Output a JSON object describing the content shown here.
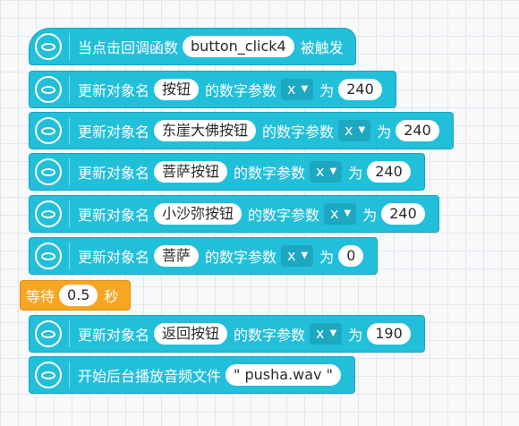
{
  "blocks": [
    {
      "kind": "hat",
      "parts": [
        {
          "t": "text",
          "v": "当点击回调函数"
        },
        {
          "t": "pill",
          "v": "button_click4"
        },
        {
          "t": "text",
          "v": "被触发"
        }
      ]
    },
    {
      "kind": "cmd",
      "parts": [
        {
          "t": "text",
          "v": "更新对象名"
        },
        {
          "t": "pill",
          "v": "按钮"
        },
        {
          "t": "text",
          "v": "的数字参数"
        },
        {
          "t": "drop",
          "v": "x"
        },
        {
          "t": "text",
          "v": "为"
        },
        {
          "t": "pill",
          "v": "240"
        }
      ]
    },
    {
      "kind": "cmd",
      "parts": [
        {
          "t": "text",
          "v": "更新对象名"
        },
        {
          "t": "pill",
          "v": "东崖大佛按钮"
        },
        {
          "t": "text",
          "v": "的数字参数"
        },
        {
          "t": "drop",
          "v": "x"
        },
        {
          "t": "text",
          "v": "为"
        },
        {
          "t": "pill",
          "v": "240"
        }
      ]
    },
    {
      "kind": "cmd",
      "parts": [
        {
          "t": "text",
          "v": "更新对象名"
        },
        {
          "t": "pill",
          "v": "菩萨按钮"
        },
        {
          "t": "text",
          "v": "的数字参数"
        },
        {
          "t": "drop",
          "v": "x"
        },
        {
          "t": "text",
          "v": "为"
        },
        {
          "t": "pill",
          "v": "240"
        }
      ]
    },
    {
      "kind": "cmd",
      "parts": [
        {
          "t": "text",
          "v": "更新对象名"
        },
        {
          "t": "pill",
          "v": "小沙弥按钮"
        },
        {
          "t": "text",
          "v": "的数字参数"
        },
        {
          "t": "drop",
          "v": "x"
        },
        {
          "t": "text",
          "v": "为"
        },
        {
          "t": "pill",
          "v": "240"
        }
      ]
    },
    {
      "kind": "cmd",
      "parts": [
        {
          "t": "text",
          "v": "更新对象名"
        },
        {
          "t": "pill",
          "v": "菩萨"
        },
        {
          "t": "text",
          "v": "的数字参数"
        },
        {
          "t": "drop",
          "v": "x"
        },
        {
          "t": "text",
          "v": "为"
        },
        {
          "t": "pill",
          "v": "0"
        }
      ]
    },
    {
      "kind": "wait",
      "parts": [
        {
          "t": "text",
          "v": "等待"
        },
        {
          "t": "pill",
          "v": "0.5"
        },
        {
          "t": "text",
          "v": "秒"
        }
      ]
    },
    {
      "kind": "cmd",
      "parts": [
        {
          "t": "text",
          "v": "更新对象名"
        },
        {
          "t": "pill",
          "v": "返回按钮"
        },
        {
          "t": "text",
          "v": "的数字参数"
        },
        {
          "t": "drop",
          "v": "x"
        },
        {
          "t": "text",
          "v": "为"
        },
        {
          "t": "pill",
          "v": "190"
        }
      ]
    },
    {
      "kind": "cmd",
      "parts": [
        {
          "t": "text",
          "v": "开始后台播放音频文件"
        },
        {
          "t": "pill",
          "v": "\" pusha.wav \""
        }
      ]
    }
  ],
  "icons": {
    "block_icon": "broadcast-icon",
    "dropdown": "caret-down-icon"
  },
  "colors": {
    "command_block": "#22bfdb",
    "wait_block": "#f6a623"
  }
}
